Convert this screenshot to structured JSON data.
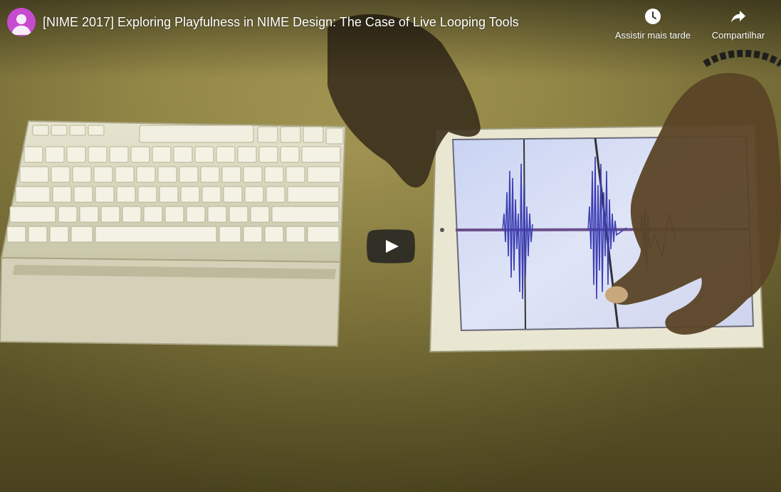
{
  "header": {
    "title": "[NIME 2017] Exploring Playfulness in NIME Design: The Case of Live Looping Tools",
    "avatar_icon": "person-icon",
    "avatar_color": "#c74bd0"
  },
  "actions": {
    "watch_later": {
      "label": "Assistir mais tarde",
      "icon": "clock-icon"
    },
    "share": {
      "label": "Compartilhar",
      "icon": "share-arrow-icon"
    }
  },
  "player": {
    "play_icon": "play-icon",
    "play_button_color": "#212121"
  }
}
